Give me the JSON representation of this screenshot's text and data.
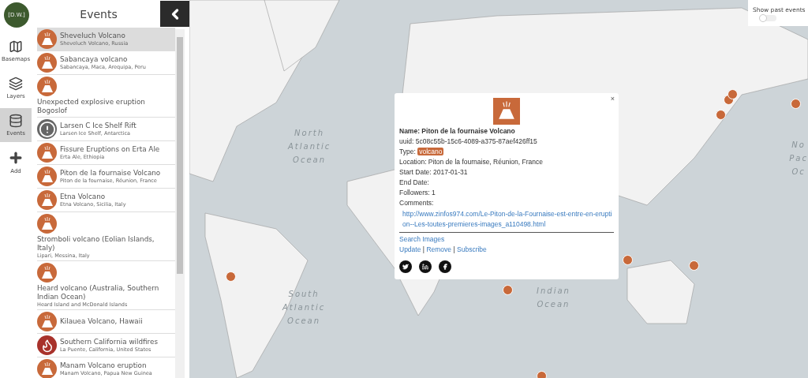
{
  "nav": {
    "avatar_text": "[D.W.]",
    "items": [
      {
        "label": "Basemaps",
        "selected": false
      },
      {
        "label": "Layers",
        "selected": false
      },
      {
        "label": "Events",
        "selected": true
      },
      {
        "label": "Add",
        "selected": false
      }
    ]
  },
  "panel": {
    "title": "Events",
    "events": [
      {
        "title": "Sheveluch Volcano",
        "location": "Sheveluch Volcano, Russia",
        "kind": "volcano",
        "selected": true
      },
      {
        "title": "Sabancaya volcano",
        "location": "Sabancaya, Maca, Arequipa, Peru",
        "kind": "volcano",
        "selected": false
      },
      {
        "title": "Unexpected explosive eruption Bogoslof",
        "kind": "volcano",
        "selected": false
      },
      {
        "title": "Larsen C Ice Shelf Rift",
        "location": "Larsen Ice Shelf, Antarctica",
        "kind": "alert",
        "selected": false
      },
      {
        "title": "Fissure Eruptions on Erta Ale",
        "location": "Erta Ale, Ethiopia",
        "kind": "volcano",
        "selected": false
      },
      {
        "title": "Piton de la fournaise Volcano",
        "location": "Piton de la fournaise, Réunion, France",
        "kind": "volcano",
        "selected": false
      },
      {
        "title": "Etna Volcano",
        "location": "Etna Volcano, Sicilia, Italy",
        "kind": "volcano",
        "selected": false
      },
      {
        "title": "Stromboli volcano (Eolian Islands, Italy)",
        "location": "Lipari, Messina, Italy",
        "kind": "volcano",
        "selected": false
      },
      {
        "title": "Heard volcano (Australia, Southern Indian Ocean)",
        "location": "Heard Island and McDonald Islands",
        "kind": "volcano",
        "selected": false
      },
      {
        "title": "Kilauea Volcano, Hawaii",
        "kind": "volcano",
        "selected": false
      },
      {
        "title": "Southern California wildfires",
        "location": "La Puente, California, United States",
        "kind": "fire",
        "selected": false
      },
      {
        "title": "Manam Volcano eruption",
        "location": "Manam Volcano, Papua New Guinea",
        "kind": "volcano",
        "selected": false
      }
    ]
  },
  "map": {
    "ocean_labels": [
      [
        "North",
        "Atlantic",
        "Ocean"
      ],
      [
        "South",
        "Atlantic",
        "Ocean"
      ],
      [
        "Indian",
        "Ocean"
      ],
      [
        "No",
        "Pac",
        "Oc"
      ]
    ],
    "past_events": {
      "label": "Show past events",
      "on": false
    },
    "popup": {
      "name_label": "Name:",
      "name": "Piton de la fournaise Volcano",
      "uuid": "uuid: 5c08c55b-15c6-4089-a375-87aef426ff15",
      "type_label": "Type:",
      "type": "volcano",
      "location": "Location: Piton de la fournaise, Réunion, France",
      "start_date": "Start Date: 2017-01-31",
      "end_date": "End Date:",
      "followers": "Followers: 1",
      "comments_label": "Comments:",
      "comment_link": "http://www.zinfos974.com/Le-Piton-de-la-Fournaise-est-entre-en-eruption--Les-toutes-premieres-images_a110498.html",
      "search_link": "Search Images",
      "actions": [
        "Update",
        "Remove",
        "Subscribe"
      ],
      "separator": "|",
      "close": "×"
    }
  }
}
